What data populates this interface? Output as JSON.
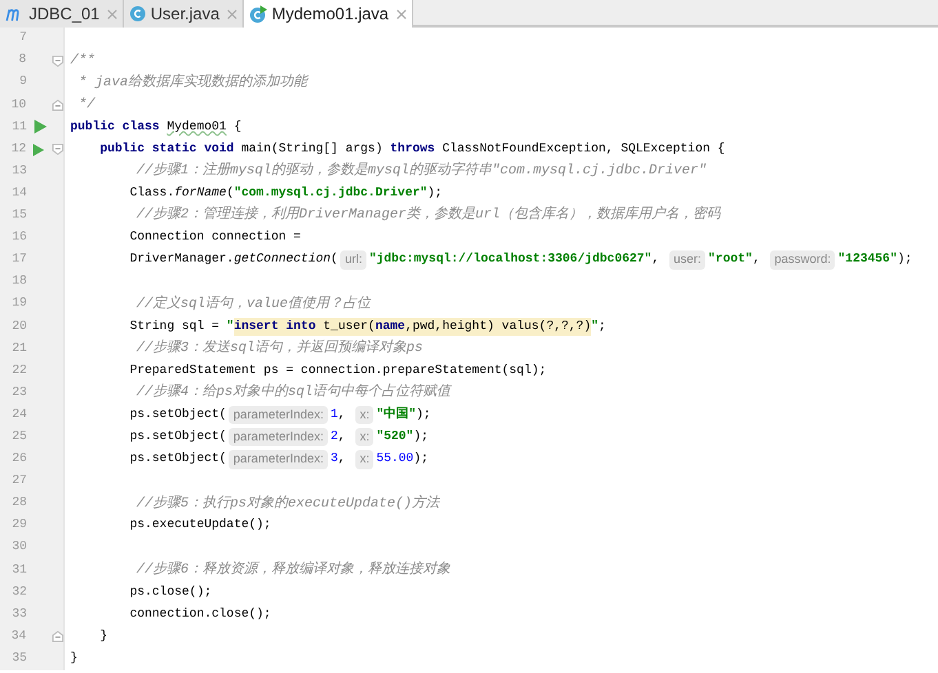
{
  "tabs": [
    {
      "label": "JDBC_01",
      "kind": "module",
      "selected": false
    },
    {
      "label": "User.java",
      "kind": "class",
      "selected": false
    },
    {
      "label": "Mydemo01.java",
      "kind": "runnable-class",
      "selected": true
    }
  ],
  "editor": {
    "lines": [
      {
        "number": "7"
      },
      {
        "number": "8",
        "fold_start": true,
        "tokens": [
          {
            "kind": "comment",
            "text": "/**"
          }
        ]
      },
      {
        "number": "9",
        "tokens": [
          {
            "kind": "comment",
            "text": " * java给数据库实现数据的添加功能"
          }
        ]
      },
      {
        "number": "10",
        "fold_end": true,
        "tokens": [
          {
            "kind": "comment",
            "text": " */"
          }
        ]
      },
      {
        "number": "11",
        "run": true,
        "tokens": [
          {
            "kind": "keyword",
            "text": "public class "
          },
          {
            "kind": "warning",
            "text": "Mydemo01"
          },
          {
            "kind": "plain",
            "text": " {"
          }
        ]
      },
      {
        "number": "12",
        "run": true,
        "fold_start": true,
        "tokens": [
          {
            "kind": "keyword",
            "text": "    public static void "
          },
          {
            "kind": "plain",
            "text": "main(String[] args) "
          },
          {
            "kind": "keyword",
            "text": "throws "
          },
          {
            "kind": "plain",
            "text": "ClassNotFoundException, SQLException {"
          }
        ]
      },
      {
        "number": "13",
        "tokens": [
          {
            "kind": "comment",
            "text": "        //步骤1：注册mysql的驱动，参数是mysql的驱动字符串\"com.mysql.cj.jdbc.Driver\""
          }
        ]
      },
      {
        "number": "14",
        "tokens": [
          {
            "kind": "plain",
            "text": "        Class."
          },
          {
            "kind": "static-method",
            "text": "forName"
          },
          {
            "kind": "plain",
            "text": "("
          },
          {
            "kind": "string",
            "text": "\"com.mysql.cj.jdbc.Driver\""
          },
          {
            "kind": "plain",
            "text": ");"
          }
        ]
      },
      {
        "number": "15",
        "tokens": [
          {
            "kind": "comment",
            "text": "        //步骤2：管理连接，利用DriverManager类，参数是url（包含库名），数据库用户名，密码"
          }
        ]
      },
      {
        "number": "16",
        "tokens": [
          {
            "kind": "plain",
            "text": "        Connection connection ="
          }
        ]
      },
      {
        "number": "17",
        "tokens": [
          {
            "kind": "plain",
            "text": "        DriverManager."
          },
          {
            "kind": "static-method",
            "text": "getConnection"
          },
          {
            "kind": "plain",
            "text": "("
          },
          {
            "kind": "hint",
            "text": "url:"
          },
          {
            "kind": "string",
            "text": "\"jdbc:mysql://localhost:3306/jdbc0627\""
          },
          {
            "kind": "plain",
            "text": ", "
          },
          {
            "kind": "hint",
            "text": "user:"
          },
          {
            "kind": "string",
            "text": "\"root\""
          },
          {
            "kind": "plain",
            "text": ", "
          },
          {
            "kind": "hint",
            "text": "password:"
          },
          {
            "kind": "string",
            "text": "\"123456\""
          },
          {
            "kind": "plain",
            "text": ");"
          }
        ]
      },
      {
        "number": "18"
      },
      {
        "number": "19",
        "tokens": [
          {
            "kind": "comment",
            "text": "        //定义sql语句，value值使用？占位"
          }
        ]
      },
      {
        "number": "20",
        "tokens": [
          {
            "kind": "plain",
            "text": "        String sql = "
          },
          {
            "kind": "string",
            "text": "\""
          },
          {
            "kind": "sql-keyword",
            "text": "insert into"
          },
          {
            "kind": "sql",
            "text": " t_user("
          },
          {
            "kind": "sql-keyword",
            "text": "name"
          },
          {
            "kind": "sql",
            "text": ",pwd,height) valus(?,?,?)"
          },
          {
            "kind": "string",
            "text": "\""
          },
          {
            "kind": "plain",
            "text": ";"
          }
        ]
      },
      {
        "number": "21",
        "tokens": [
          {
            "kind": "comment",
            "text": "        //步骤3：发送sql语句，并返回预编译对象ps"
          }
        ]
      },
      {
        "number": "22",
        "tokens": [
          {
            "kind": "plain",
            "text": "        PreparedStatement ps = connection.prepareStatement(sql);"
          }
        ]
      },
      {
        "number": "23",
        "tokens": [
          {
            "kind": "comment",
            "text": "        //步骤4：给ps对象中的sql语句中每个占位符赋值"
          }
        ]
      },
      {
        "number": "24",
        "tokens": [
          {
            "kind": "plain",
            "text": "        ps.setObject("
          },
          {
            "kind": "hint",
            "text": "parameterIndex:"
          },
          {
            "kind": "number",
            "text": "1"
          },
          {
            "kind": "plain",
            "text": ", "
          },
          {
            "kind": "hint",
            "text": "x:"
          },
          {
            "kind": "string",
            "text": "\"中国\""
          },
          {
            "kind": "plain",
            "text": ");"
          }
        ]
      },
      {
        "number": "25",
        "tokens": [
          {
            "kind": "plain",
            "text": "        ps.setObject("
          },
          {
            "kind": "hint",
            "text": "parameterIndex:"
          },
          {
            "kind": "number",
            "text": "2"
          },
          {
            "kind": "plain",
            "text": ", "
          },
          {
            "kind": "hint",
            "text": "x:"
          },
          {
            "kind": "string",
            "text": "\"520\""
          },
          {
            "kind": "plain",
            "text": ");"
          }
        ]
      },
      {
        "number": "26",
        "tokens": [
          {
            "kind": "plain",
            "text": "        ps.setObject("
          },
          {
            "kind": "hint",
            "text": "parameterIndex:"
          },
          {
            "kind": "number",
            "text": "3"
          },
          {
            "kind": "plain",
            "text": ", "
          },
          {
            "kind": "hint",
            "text": "x:"
          },
          {
            "kind": "number",
            "text": "55.00"
          },
          {
            "kind": "plain",
            "text": ");"
          }
        ]
      },
      {
        "number": "27"
      },
      {
        "number": "28",
        "tokens": [
          {
            "kind": "comment",
            "text": "        //步骤5：执行ps对象的executeUpdate()方法"
          }
        ]
      },
      {
        "number": "29",
        "tokens": [
          {
            "kind": "plain",
            "text": "        ps.executeUpdate();"
          }
        ]
      },
      {
        "number": "30"
      },
      {
        "number": "31",
        "tokens": [
          {
            "kind": "comment",
            "text": "        //步骤6：释放资源，释放编译对象，释放连接对象"
          }
        ]
      },
      {
        "number": "32",
        "tokens": [
          {
            "kind": "plain",
            "text": "        ps.close();"
          }
        ]
      },
      {
        "number": "33",
        "tokens": [
          {
            "kind": "plain",
            "text": "        connection.close();"
          }
        ]
      },
      {
        "number": "34",
        "fold_end": true,
        "tokens": [
          {
            "kind": "plain",
            "text": "    }"
          }
        ]
      },
      {
        "number": "35",
        "tokens": [
          {
            "kind": "plain",
            "text": "}"
          }
        ]
      }
    ]
  }
}
